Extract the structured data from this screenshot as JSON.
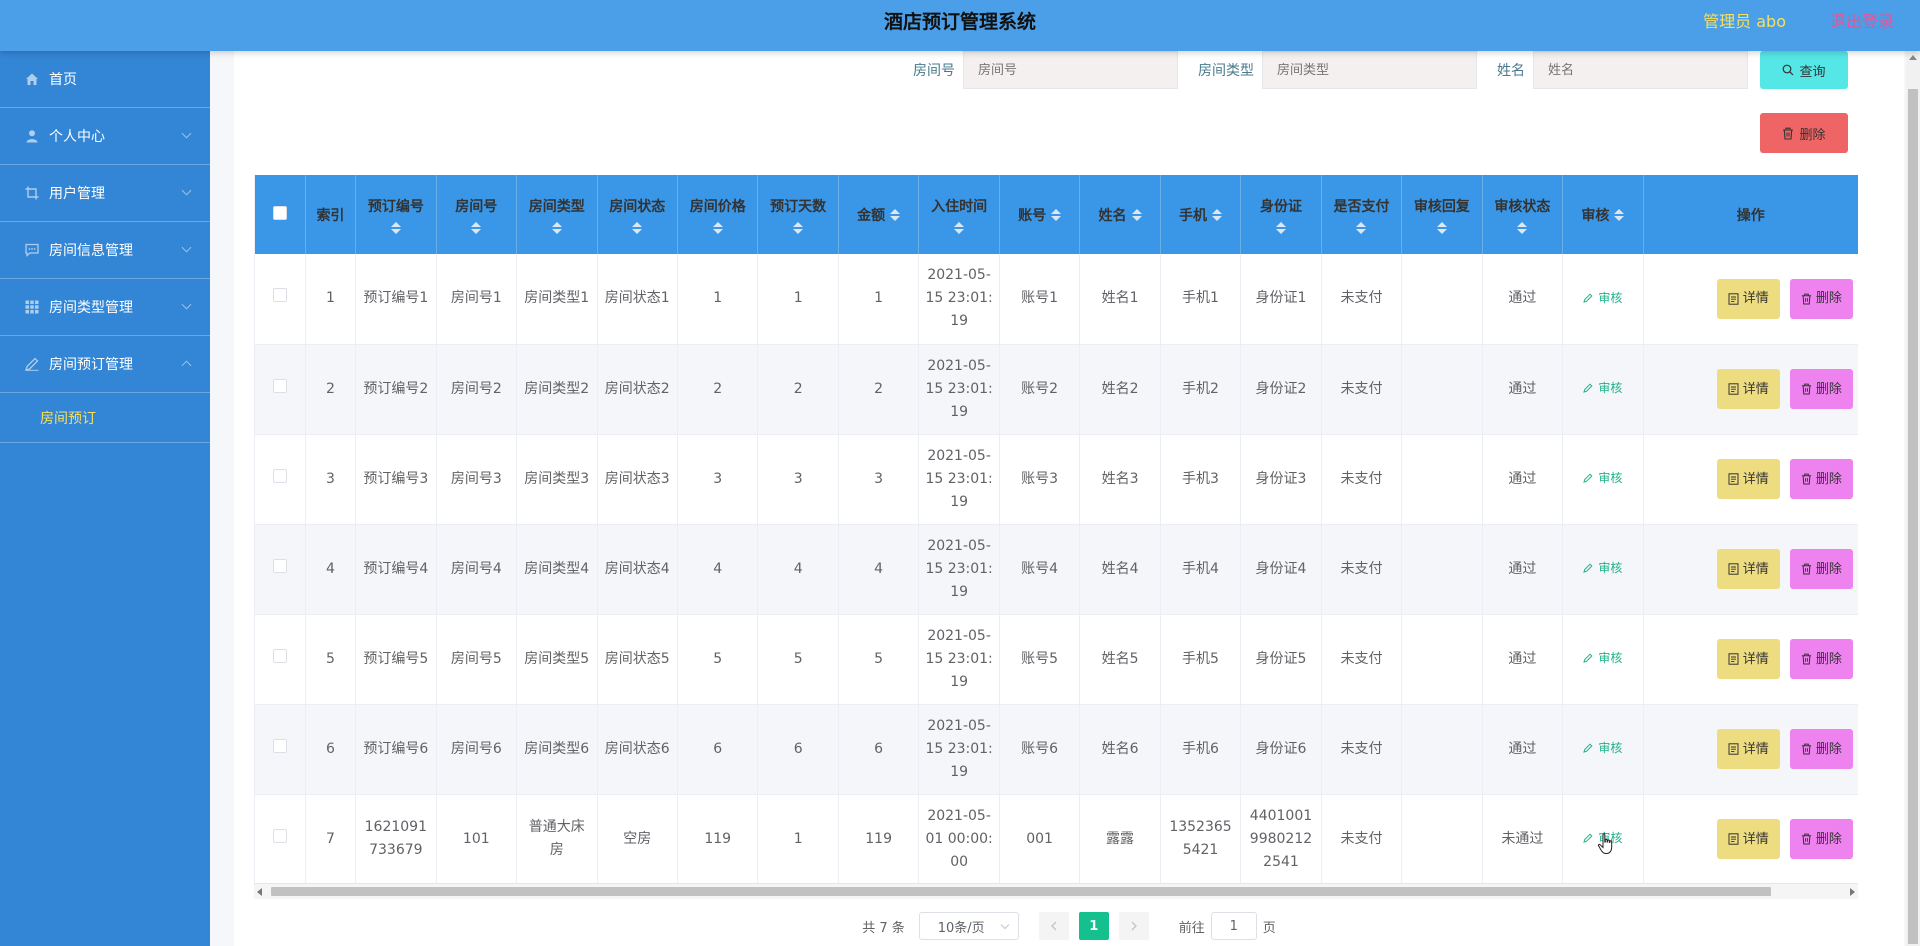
{
  "header": {
    "title": "酒店预订管理系统",
    "admin": "管理员 abo",
    "logout": "退出登录"
  },
  "sidebar": {
    "items": [
      {
        "label": "首页",
        "icon": "home-icon"
      },
      {
        "label": "个人中心",
        "icon": "user-icon"
      },
      {
        "label": "用户管理",
        "icon": "crop-icon"
      },
      {
        "label": "房间信息管理",
        "icon": "chat-icon"
      },
      {
        "label": "房间类型管理",
        "icon": "grid-icon"
      },
      {
        "label": "房间预订管理",
        "icon": "edit-icon"
      }
    ],
    "sub_item": "房间预订"
  },
  "search": {
    "room_no_label": "房间号",
    "room_no_placeholder": "房间号",
    "room_type_label": "房间类型",
    "room_type_placeholder": "房间类型",
    "name_label": "姓名",
    "name_placeholder": "姓名",
    "query_button": "查询"
  },
  "toolbar": {
    "delete_button": "删除"
  },
  "table": {
    "columns": [
      "索引",
      "预订编号",
      "房间号",
      "房间类型",
      "房间状态",
      "房间价格",
      "预订天数",
      "金额",
      "入住时间",
      "账号",
      "姓名",
      "手机",
      "身份证",
      "是否支付",
      "审核回复",
      "审核状态",
      "审核",
      "操作"
    ],
    "audit_link": "审核",
    "detail_button": "详情",
    "delete_button": "删除",
    "rows": [
      {
        "index": "1",
        "order_no": "预订编号1",
        "room_no": "房间号1",
        "room_type": "房间类型1",
        "room_status": "房间状态1",
        "price": "1",
        "days": "1",
        "amount": "1",
        "checkin": "2021-05-15 23:01:19",
        "account": "账号1",
        "name": "姓名1",
        "phone": "手机1",
        "id_card": "身份证1",
        "paid": "未支付",
        "reply": "",
        "audit_status": "通过"
      },
      {
        "index": "2",
        "order_no": "预订编号2",
        "room_no": "房间号2",
        "room_type": "房间类型2",
        "room_status": "房间状态2",
        "price": "2",
        "days": "2",
        "amount": "2",
        "checkin": "2021-05-15 23:01:19",
        "account": "账号2",
        "name": "姓名2",
        "phone": "手机2",
        "id_card": "身份证2",
        "paid": "未支付",
        "reply": "",
        "audit_status": "通过"
      },
      {
        "index": "3",
        "order_no": "预订编号3",
        "room_no": "房间号3",
        "room_type": "房间类型3",
        "room_status": "房间状态3",
        "price": "3",
        "days": "3",
        "amount": "3",
        "checkin": "2021-05-15 23:01:19",
        "account": "账号3",
        "name": "姓名3",
        "phone": "手机3",
        "id_card": "身份证3",
        "paid": "未支付",
        "reply": "",
        "audit_status": "通过"
      },
      {
        "index": "4",
        "order_no": "预订编号4",
        "room_no": "房间号4",
        "room_type": "房间类型4",
        "room_status": "房间状态4",
        "price": "4",
        "days": "4",
        "amount": "4",
        "checkin": "2021-05-15 23:01:19",
        "account": "账号4",
        "name": "姓名4",
        "phone": "手机4",
        "id_card": "身份证4",
        "paid": "未支付",
        "reply": "",
        "audit_status": "通过"
      },
      {
        "index": "5",
        "order_no": "预订编号5",
        "room_no": "房间号5",
        "room_type": "房间类型5",
        "room_status": "房间状态5",
        "price": "5",
        "days": "5",
        "amount": "5",
        "checkin": "2021-05-15 23:01:19",
        "account": "账号5",
        "name": "姓名5",
        "phone": "手机5",
        "id_card": "身份证5",
        "paid": "未支付",
        "reply": "",
        "audit_status": "通过"
      },
      {
        "index": "6",
        "order_no": "预订编号6",
        "room_no": "房间号6",
        "room_type": "房间类型6",
        "room_status": "房间状态6",
        "price": "6",
        "days": "6",
        "amount": "6",
        "checkin": "2021-05-15 23:01:19",
        "account": "账号6",
        "name": "姓名6",
        "phone": "手机6",
        "id_card": "身份证6",
        "paid": "未支付",
        "reply": "",
        "audit_status": "通过"
      },
      {
        "index": "7",
        "order_no": "1621091733679",
        "room_no": "101",
        "room_type": "普通大床房",
        "room_status": "空房",
        "price": "119",
        "days": "1",
        "amount": "119",
        "checkin": "2021-05-01 00:00:00",
        "account": "001",
        "name": "露露",
        "phone": "13523655421",
        "id_card": "440100199802122541",
        "paid": "未支付",
        "reply": "",
        "audit_status": "未通过"
      }
    ]
  },
  "pagination": {
    "total": "共 7 条",
    "page_size": "10条/页",
    "current_page": "1",
    "goto_prefix": "前往",
    "goto_value": "1",
    "goto_suffix": "页"
  },
  "colors": {
    "header_bg": "#4a9fe8",
    "sidebar_bg": "#3385d6",
    "table_header_bg": "#3a96e6",
    "accent_yellow": "#f6e05e",
    "query_button": "#55e6e6",
    "delete_button": "#ef6464",
    "detail_button": "#eedd80",
    "row_delete_button": "#ee82ee",
    "page_active": "#13c08e"
  }
}
